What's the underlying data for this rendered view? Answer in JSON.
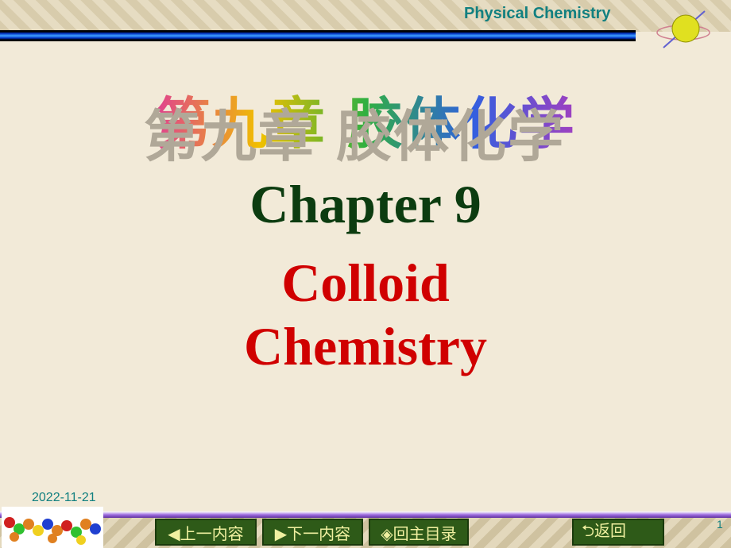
{
  "header": {
    "title": "Physical Chemistry"
  },
  "slide": {
    "chinese_title": "第九章 胶体化学",
    "chapter": "Chapter 9",
    "subtitle_line1": "Colloid",
    "subtitle_line2": "Chemistry"
  },
  "footer": {
    "date": "2022-11-21",
    "page_number": "1",
    "buttons": {
      "prev": "◀上一内容",
      "next": "▶下一内容",
      "home": "◈回主目录",
      "back": "⮌返回"
    }
  }
}
